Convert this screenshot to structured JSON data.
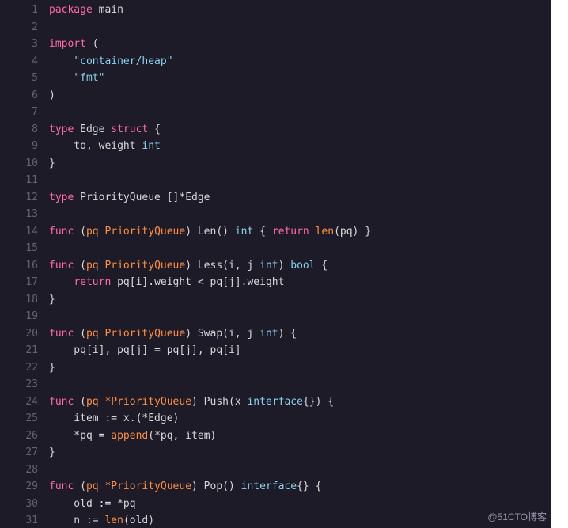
{
  "watermark": "@51CTO博客",
  "lines": [
    {
      "n": 1,
      "t": [
        [
          "kw",
          "package"
        ],
        [
          "ident",
          " "
        ],
        [
          "ident",
          "main"
        ]
      ]
    },
    {
      "n": 2,
      "t": []
    },
    {
      "n": 3,
      "t": [
        [
          "kw",
          "import"
        ],
        [
          "ident",
          " ("
        ]
      ]
    },
    {
      "n": 4,
      "t": [
        [
          "ident",
          "    "
        ],
        [
          "str",
          "\"container/heap\""
        ]
      ]
    },
    {
      "n": 5,
      "t": [
        [
          "ident",
          "    "
        ],
        [
          "str",
          "\"fmt\""
        ]
      ]
    },
    {
      "n": 6,
      "t": [
        [
          "ident",
          ")"
        ]
      ]
    },
    {
      "n": 7,
      "t": []
    },
    {
      "n": 8,
      "t": [
        [
          "kw",
          "type"
        ],
        [
          "ident",
          " Edge "
        ],
        [
          "kw",
          "struct"
        ],
        [
          "ident",
          " {"
        ]
      ]
    },
    {
      "n": 9,
      "t": [
        [
          "ident",
          "    to, weight "
        ],
        [
          "type",
          "int"
        ]
      ]
    },
    {
      "n": 10,
      "t": [
        [
          "ident",
          "}"
        ]
      ]
    },
    {
      "n": 11,
      "t": []
    },
    {
      "n": 12,
      "t": [
        [
          "kw",
          "type"
        ],
        [
          "ident",
          " PriorityQueue []*Edge"
        ]
      ]
    },
    {
      "n": 13,
      "t": []
    },
    {
      "n": 14,
      "t": [
        [
          "kw",
          "func"
        ],
        [
          "ident",
          " ("
        ],
        [
          "recv",
          "pq"
        ],
        [
          "ident",
          " "
        ],
        [
          "recv",
          "PriorityQueue"
        ],
        [
          "ident",
          ") Len() "
        ],
        [
          "type",
          "int"
        ],
        [
          "ident",
          " { "
        ],
        [
          "kw",
          "return"
        ],
        [
          "ident",
          " "
        ],
        [
          "builtin",
          "len"
        ],
        [
          "ident",
          "(pq) }"
        ]
      ]
    },
    {
      "n": 15,
      "t": []
    },
    {
      "n": 16,
      "t": [
        [
          "kw",
          "func"
        ],
        [
          "ident",
          " ("
        ],
        [
          "recv",
          "pq"
        ],
        [
          "ident",
          " "
        ],
        [
          "recv",
          "PriorityQueue"
        ],
        [
          "ident",
          ") Less(i, j "
        ],
        [
          "type",
          "int"
        ],
        [
          "ident",
          ") "
        ],
        [
          "type",
          "bool"
        ],
        [
          "ident",
          " {"
        ]
      ]
    },
    {
      "n": 17,
      "t": [
        [
          "ident",
          "    "
        ],
        [
          "kw",
          "return"
        ],
        [
          "ident",
          " pq[i].weight < pq[j].weight"
        ]
      ]
    },
    {
      "n": 18,
      "t": [
        [
          "ident",
          "}"
        ]
      ]
    },
    {
      "n": 19,
      "t": []
    },
    {
      "n": 20,
      "t": [
        [
          "kw",
          "func"
        ],
        [
          "ident",
          " ("
        ],
        [
          "recv",
          "pq"
        ],
        [
          "ident",
          " "
        ],
        [
          "recv",
          "PriorityQueue"
        ],
        [
          "ident",
          ") Swap(i, j "
        ],
        [
          "type",
          "int"
        ],
        [
          "ident",
          ") {"
        ]
      ]
    },
    {
      "n": 21,
      "t": [
        [
          "ident",
          "    pq[i], pq[j] = pq[j], pq[i]"
        ]
      ]
    },
    {
      "n": 22,
      "t": [
        [
          "ident",
          "}"
        ]
      ]
    },
    {
      "n": 23,
      "t": []
    },
    {
      "n": 24,
      "t": [
        [
          "kw",
          "func"
        ],
        [
          "ident",
          " ("
        ],
        [
          "recv",
          "pq"
        ],
        [
          "ident",
          " "
        ],
        [
          "recv",
          "*PriorityQueue"
        ],
        [
          "ident",
          ") Push(x "
        ],
        [
          "type",
          "interface"
        ],
        [
          "ident",
          "{}) {"
        ]
      ]
    },
    {
      "n": 25,
      "t": [
        [
          "ident",
          "    item := x.(*Edge)"
        ]
      ]
    },
    {
      "n": 26,
      "t": [
        [
          "ident",
          "    *pq = "
        ],
        [
          "builtin",
          "append"
        ],
        [
          "ident",
          "(*pq, item)"
        ]
      ]
    },
    {
      "n": 27,
      "t": [
        [
          "ident",
          "}"
        ]
      ]
    },
    {
      "n": 28,
      "t": []
    },
    {
      "n": 29,
      "t": [
        [
          "kw",
          "func"
        ],
        [
          "ident",
          " ("
        ],
        [
          "recv",
          "pq"
        ],
        [
          "ident",
          " "
        ],
        [
          "recv",
          "*PriorityQueue"
        ],
        [
          "ident",
          ") Pop() "
        ],
        [
          "type",
          "interface"
        ],
        [
          "ident",
          "{} {"
        ]
      ]
    },
    {
      "n": 30,
      "t": [
        [
          "ident",
          "    old := *pq"
        ]
      ]
    },
    {
      "n": 31,
      "t": [
        [
          "ident",
          "    n := "
        ],
        [
          "builtin",
          "len"
        ],
        [
          "ident",
          "(old)"
        ]
      ]
    }
  ]
}
